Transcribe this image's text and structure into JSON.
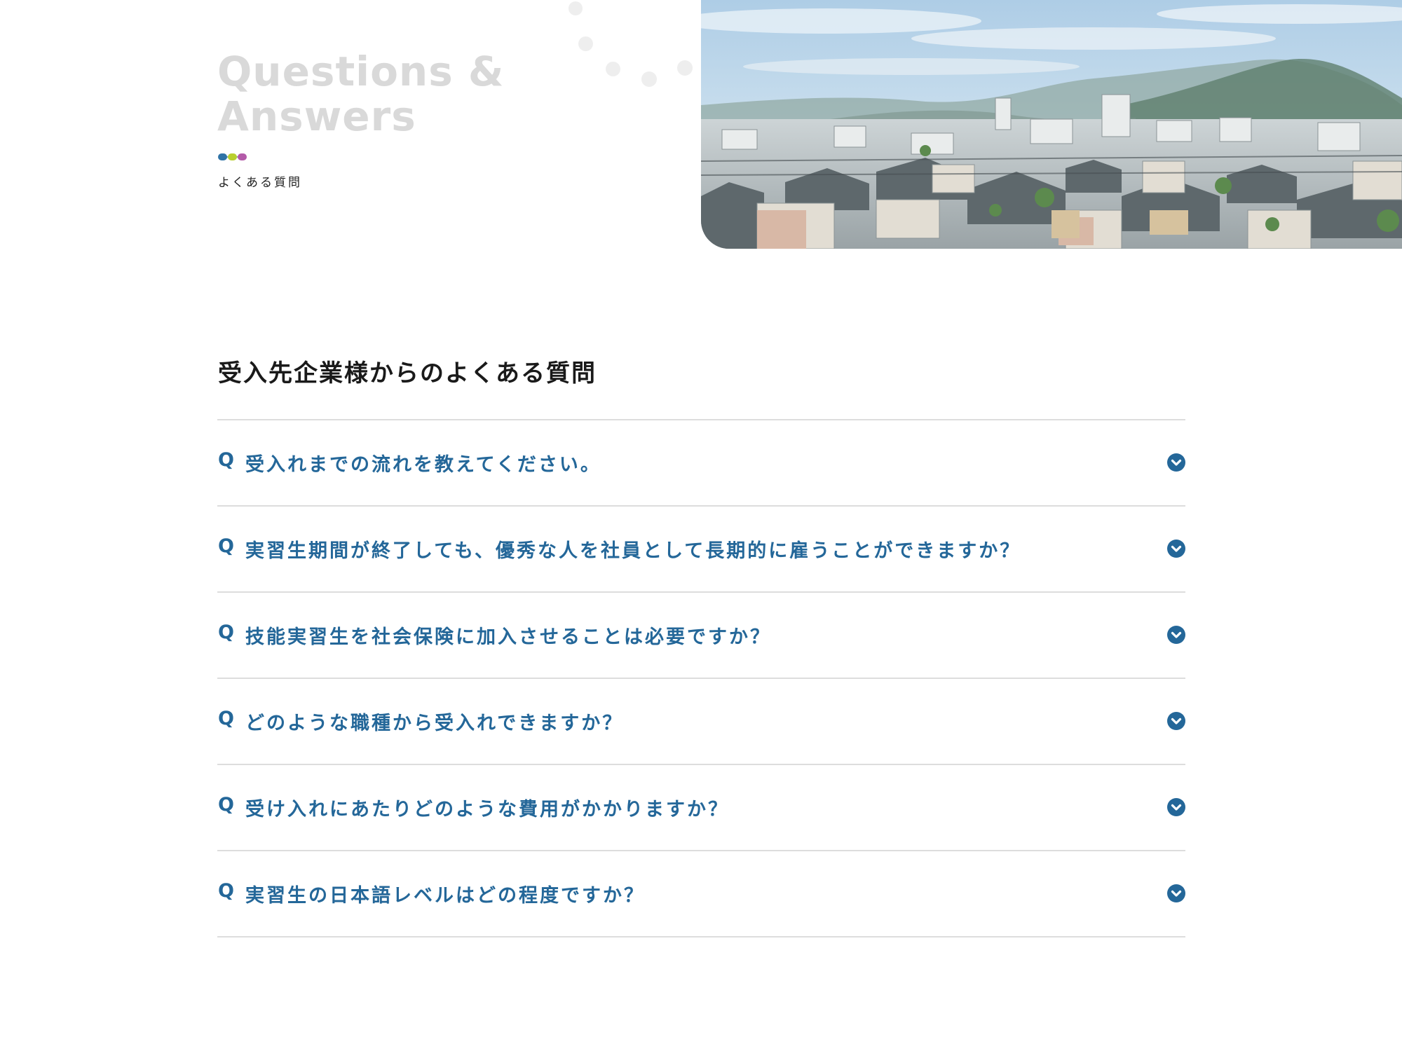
{
  "hero": {
    "heading_line1": "Questions &",
    "heading_line2": "Answers",
    "subtitle": "よくある質問",
    "dot_colors": [
      "#2f73a6",
      "#b9cf2f",
      "#b35aa8"
    ]
  },
  "faq": {
    "section_title": "受入先企業様からのよくある質問",
    "q_marker": "Q",
    "accent_color": "#246799",
    "items": [
      {
        "question": "受入れまでの流れを教えてください。"
      },
      {
        "question": "実習生期間が終了しても、優秀な人を社員として長期的に雇うことができますか？"
      },
      {
        "question": "技能実習生を社会保険に加入させることは必要ですか？"
      },
      {
        "question": "どのような職種から受入れできますか？"
      },
      {
        "question": "受け入れにあたりどのような費用がかかりますか？"
      },
      {
        "question": "実習生の日本語レベルはどの程度ですか？"
      }
    ],
    "toggle_icon": "chevron-down-circle-icon"
  }
}
